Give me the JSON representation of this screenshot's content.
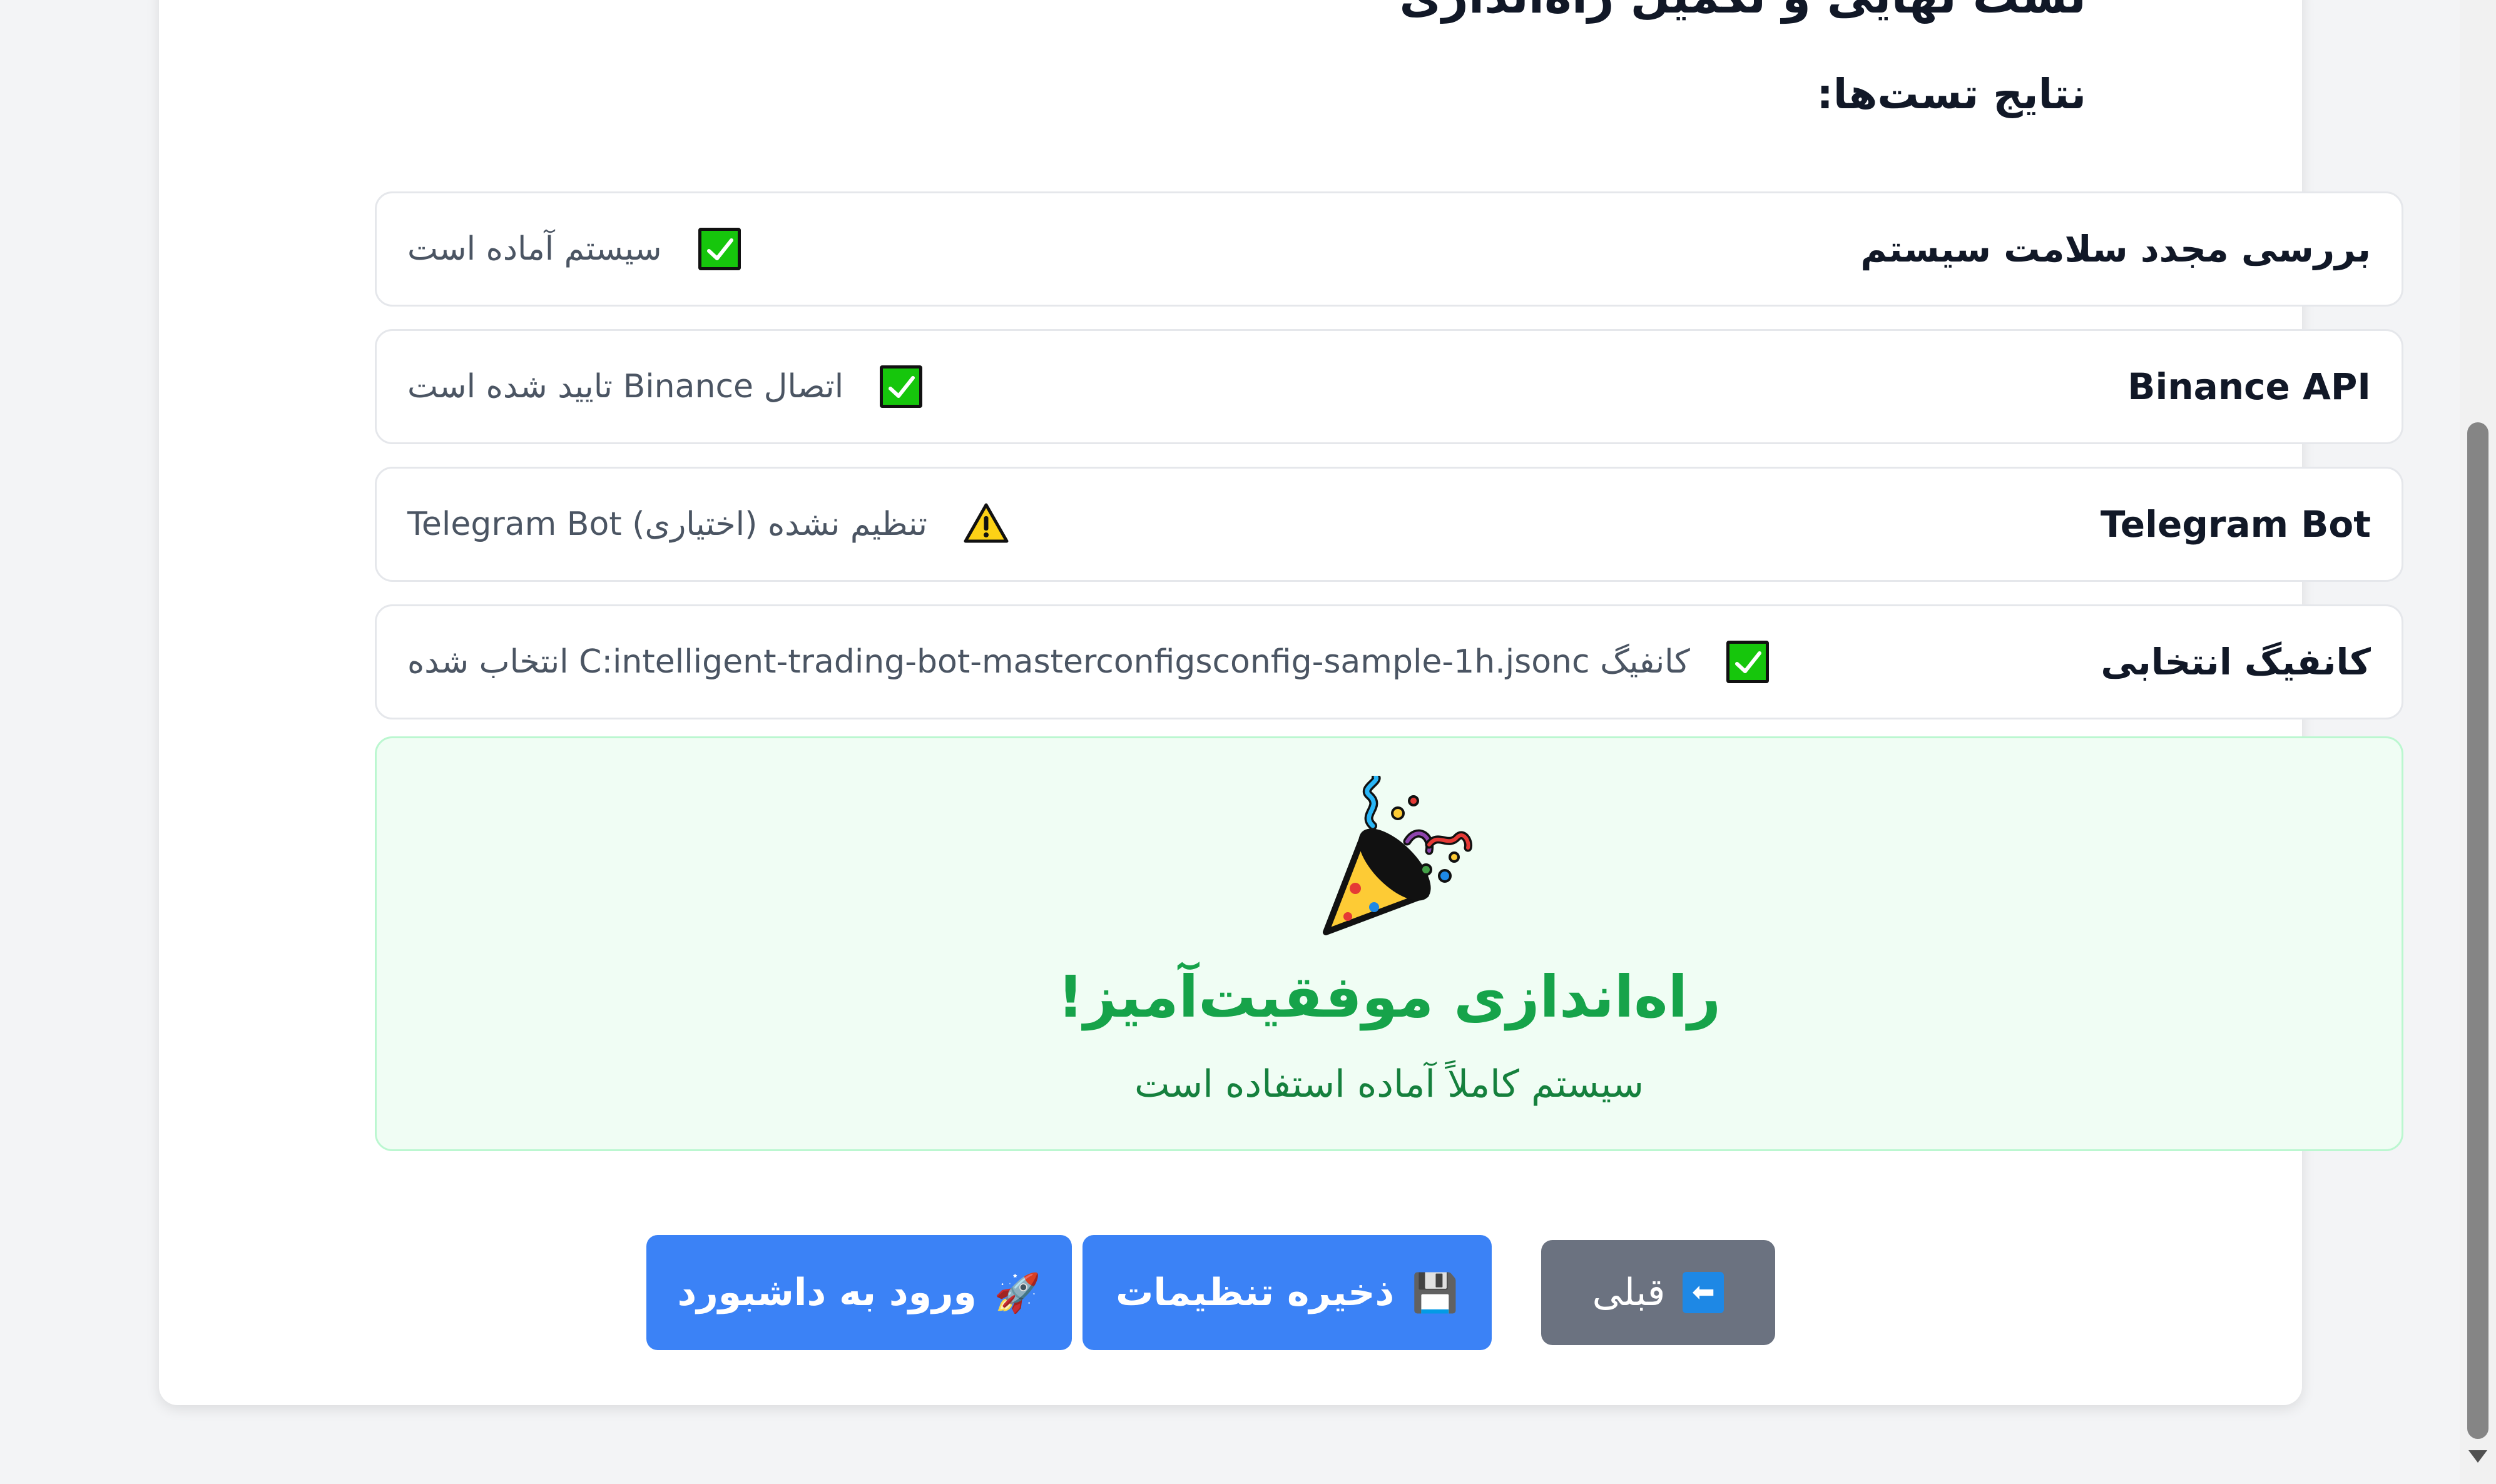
{
  "page": {
    "title": "تست نهایی و تکمیل راه‌اندازی",
    "results_heading": "نتایج تست‌ها:"
  },
  "tests": [
    {
      "name": "بررسی مجدد سلامت سیستم",
      "status_icon": "check-mark-button-icon",
      "status": "سیستم آماده است"
    },
    {
      "name": "Binance API",
      "status_icon": "check-mark-button-icon",
      "status": "اتصال Binance تایید شده است"
    },
    {
      "name": "Telegram Bot",
      "status_icon": "warning-icon",
      "status": "Telegram Bot تنظیم نشده (اختیاری)"
    },
    {
      "name": "کانفیگ انتخابی",
      "status_icon": "check-mark-button-icon",
      "status": "کانفیگ C:intelligent-trading-bot-masterconfigsconfig-sample-1h.jsonc انتخاب شده"
    }
  ],
  "success": {
    "icon": "party-popper-icon",
    "title": "راه‌اندازی موفقیت‌آمیز!",
    "subtitle": "سیستم کاملاً آماده استفاده است"
  },
  "buttons": {
    "dashboard": {
      "emoji": "🚀",
      "label": "ورود به داشبورد"
    },
    "save": {
      "emoji": "💾",
      "label": "ذخیره تنظیمات"
    },
    "previous": {
      "emoji": "⬅",
      "label": "قبلی"
    }
  },
  "colors": {
    "primary": "#3b82f6",
    "secondary": "#6b7280",
    "success_text": "#16a34a",
    "success_bg": "#f0fdf4",
    "check_green": "#16c60c",
    "warning_yellow": "#fcd116"
  }
}
